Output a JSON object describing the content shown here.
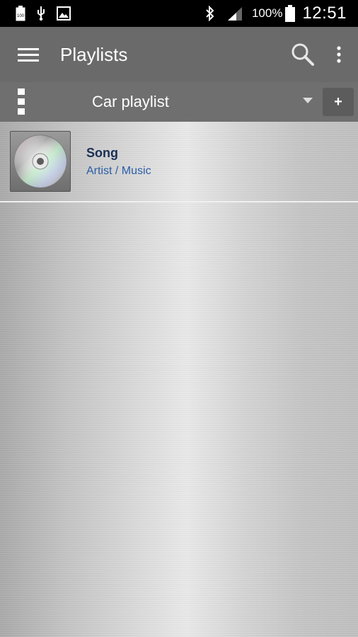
{
  "status_bar": {
    "battery_percent": "100%",
    "time": "12:51",
    "icons": [
      "battery-100-icon",
      "usb-icon",
      "image-notification-icon",
      "bluetooth-icon",
      "signal-icon",
      "battery-icon"
    ]
  },
  "app_bar": {
    "title": "Playlists",
    "menu_icon": "hamburger-menu-icon",
    "search_icon": "search-icon",
    "overflow_icon": "more-vert-icon"
  },
  "playlist_bar": {
    "selected_playlist": "Car playlist",
    "add_label": "+"
  },
  "songs": [
    {
      "title": "Song",
      "subtitle": "Artist / Music",
      "art_icon": "cd-disc-icon"
    }
  ],
  "colors": {
    "status_bar": "#000000",
    "app_bar": "#6a6a6a",
    "song_title": "#1b2f55",
    "song_subtitle": "#2a5ea8"
  }
}
